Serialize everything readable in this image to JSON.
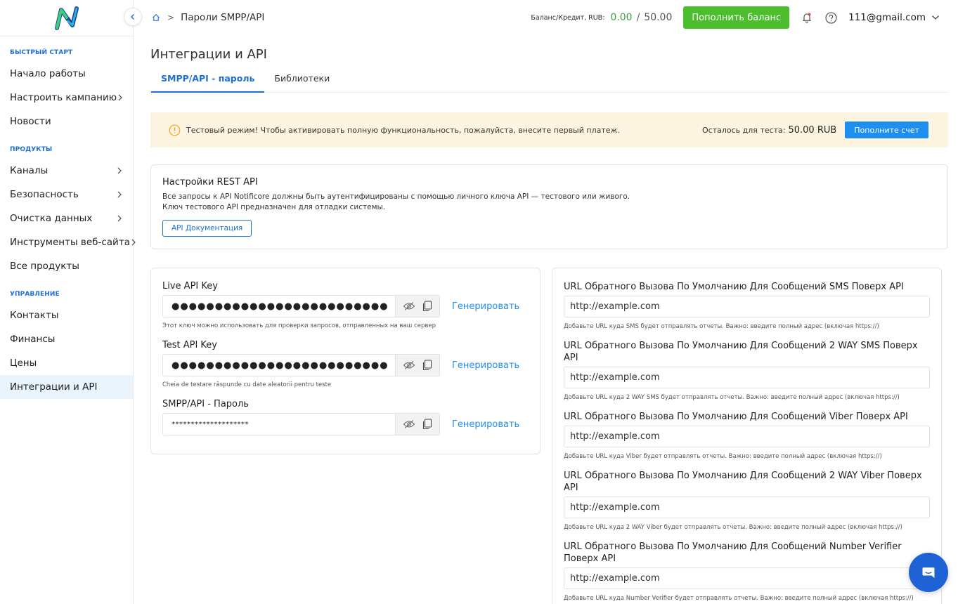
{
  "app": {
    "logo_name": "notificore-logo"
  },
  "sidebar": {
    "sections": [
      {
        "label": "БЫСТРЫЙ СТАРТ",
        "items": [
          {
            "label": "Начало работы",
            "has_arrow": false
          },
          {
            "label": "Настроить кампанию",
            "has_arrow": true
          },
          {
            "label": "Новости",
            "has_arrow": false
          }
        ]
      },
      {
        "label": "ПРОДУКТЫ",
        "items": [
          {
            "label": "Каналы",
            "has_arrow": true
          },
          {
            "label": "Безопасность",
            "has_arrow": true
          },
          {
            "label": "Очистка данных",
            "has_arrow": true
          },
          {
            "label": "Инструменты веб-сайта",
            "has_arrow": true
          },
          {
            "label": "Все продукты",
            "has_arrow": false
          }
        ]
      },
      {
        "label": "УПРАВЛЕНИЕ",
        "items": [
          {
            "label": "Контакты",
            "has_arrow": false
          },
          {
            "label": "Финансы",
            "has_arrow": false
          },
          {
            "label": "Цены",
            "has_arrow": false
          },
          {
            "label": "Интеграции и API",
            "has_arrow": false,
            "active": true
          }
        ]
      }
    ]
  },
  "topbar": {
    "breadcrumb": "Пароли SMPP/API",
    "balance_label": "Баланс/Кредит, RUB:",
    "balance_value": "0.00",
    "balance_slash": "/",
    "balance_total": "50.00",
    "topup_label": "Пополнить баланс",
    "user_email": "111@gmail.com"
  },
  "main": {
    "title": "Интеграции и API",
    "tabs": [
      {
        "label": "SMPP/API - пароль",
        "active": true
      },
      {
        "label": "Библиотеки",
        "active": false
      }
    ],
    "banner": {
      "text": "Тестовый режим! Чтобы активировать полную функциональность, пожалуйста, внесите первый платеж.",
      "remaining_label": "Осталось для теста:",
      "remaining_amount": "50.00 RUB",
      "button_label": "Пополните счет"
    },
    "rest": {
      "title": "Настройки REST API",
      "line1": "Все запросы к API Notificore должны быть аутентифицированы с помощью личного ключа API — тестового или живого.",
      "line2": "Ключ тестового API предназначен для отладки системы.",
      "doc_button": "API Документация"
    },
    "keys": [
      {
        "label": "Live API Key",
        "value": "●●●●●●●●●●●●●●●●●●●●●●●●●",
        "small": false,
        "generate": "Генерировать",
        "hint": "Этот ключ можно использовать для проверки запросов, отправленных на ваш сервер"
      },
      {
        "label": "Test API Key",
        "value": "●●●●●●●●●●●●●●●●●●●●●●●●●",
        "small": false,
        "generate": "Генерировать",
        "hint": "Cheia de testare răspunde cu date aleatorii pentru teste"
      },
      {
        "label": "SMPP/API - Пароль",
        "value": "********************",
        "small": true,
        "generate": "Генерировать",
        "hint": ""
      }
    ],
    "callbacks": [
      {
        "label": "URL Обратного Вызова По Умолчанию Для Сообщений SMS Поверх API",
        "placeholder": "http://example.com",
        "hint": "Добавьте URL куда SMS будет отправлять отчеты. Важно: введите полный адрес (включая https://)"
      },
      {
        "label": "URL Обратного Вызова По Умолчанию Для Сообщений 2 WAY SMS Поверх API",
        "placeholder": "http://example.com",
        "hint": "Добавьте URL куда 2 WAY SMS будет отправлять отчеты. Важно: введите полный адрес (включая https://)"
      },
      {
        "label": "URL Обратного Вызова По Умолчанию Для Сообщений Viber Поверх API",
        "placeholder": "http://example.com",
        "hint": "Добавьте URL куда Viber будет отправлять отчеты. Важно: введите полный адрес (включая https://)"
      },
      {
        "label": "URL Обратного Вызова По Умолчанию Для Сообщений 2 WAY Viber Поверх API",
        "placeholder": "http://example.com",
        "hint": "Добавьте URL куда 2 WAY Viber будет отправлять отчеты. Важно: введите полный адрес (включая https://)"
      },
      {
        "label": "URL Обратного Вызова По Умолчанию Для Сообщений Number Verifier Поверх API",
        "placeholder": "http://example.com",
        "hint": "Добавьте URL куда Number Verifier будет отправлять отчеты. Важно: введите полный адрес (включая https://)"
      }
    ]
  },
  "colors": {
    "accent": "#1f6fd8",
    "link": "#1f8ef0",
    "topup": "#4cbe2e",
    "balance": "#3aa53a",
    "banner_bg": "#fdf5e2",
    "chat": "#1e62d6"
  }
}
